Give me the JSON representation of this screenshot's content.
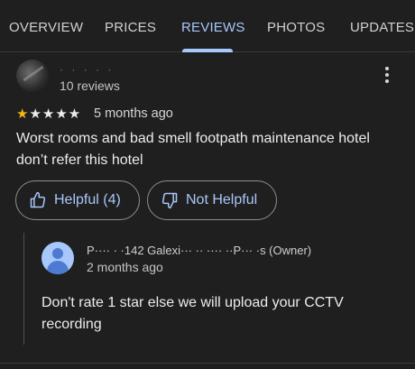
{
  "tabs": [
    {
      "label": "OVERVIEW"
    },
    {
      "label": "PRICES"
    },
    {
      "label": "REVIEWS",
      "active": true
    },
    {
      "label": "PHOTOS"
    },
    {
      "label": "UPDATES"
    }
  ],
  "review": {
    "reviewer_name": "· · · · ·",
    "review_count": "10 reviews",
    "rating": 1,
    "stars": {
      "filled": "★",
      "empty": "★★★★"
    },
    "date": "5 months ago",
    "text": "Worst rooms and bad smell footpath maintenance hotel don’t refer this hotel",
    "helpful_label": "Helpful (4)",
    "not_helpful_label": "Not Helpful"
  },
  "reply": {
    "owner_name": "P···· · ·142 Galexi··· ·· ···· ··P··· ·s (Owner)",
    "date": "2 months ago",
    "text": "Don't rate 1 star else we will upload your CCTV recording"
  },
  "colors": {
    "background": "#1f1f1f",
    "accent": "#a8c7fa",
    "star": "#f6b515"
  }
}
